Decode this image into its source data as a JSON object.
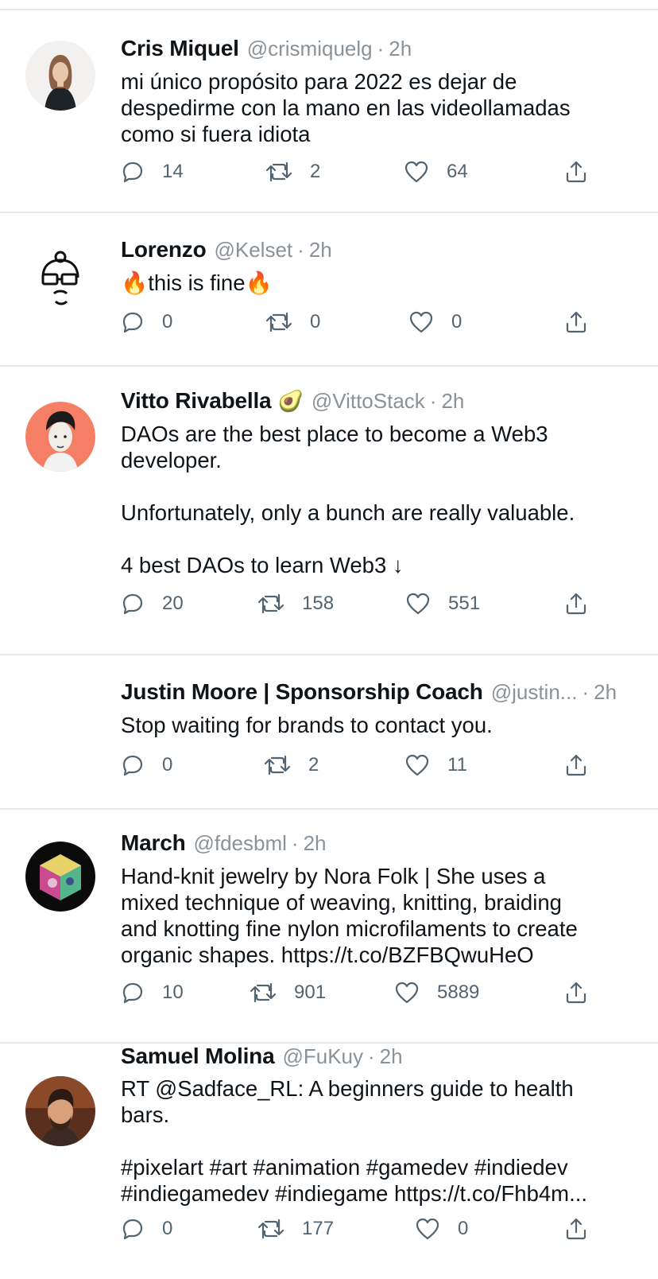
{
  "tweets": [
    {
      "name": "Cris Miquel",
      "handle": "@crismiquelg",
      "sep": "·",
      "time": "2h",
      "text": "mi único propósito para 2022 es dejar de\ndespedirme con la mano en las videollamadas\ncomo si fuera idiota",
      "replies": "14",
      "retweets": "2",
      "likes": "64"
    },
    {
      "name": "Lorenzo",
      "handle": "@Kelset",
      "sep": "·",
      "time": "2h",
      "text": "🔥this is fine🔥",
      "replies": "0",
      "retweets": "0",
      "likes": "0"
    },
    {
      "name": "Vitto Rivabella",
      "badge": "🥑",
      "handle": "@VittoStack",
      "sep": "·",
      "time": "2h",
      "text": "DAOs are the best place to become a Web3\ndeveloper.\n\nUnfortunately, only a bunch are really valuable.\n\n4 best DAOs to learn Web3  ↓",
      "replies": "20",
      "retweets": "158",
      "likes": "551"
    },
    {
      "name": "Justin Moore | Sponsorship Coach",
      "handle": "@justin...",
      "sep": "·",
      "time": "2h",
      "text": "Stop waiting for brands to contact you.",
      "replies": "0",
      "retweets": "2",
      "likes": "11"
    },
    {
      "name": "March",
      "handle": "@fdesbml",
      "sep": "·",
      "time": "2h",
      "text": "Hand-knit jewelry by Nora Folk | She uses a\nmixed technique of weaving, knitting, braiding\nand knotting fine nylon microfilaments to create\norganic shapes. https://t.co/BZFBQwuHeO",
      "replies": "10",
      "retweets": "901",
      "likes": "5889"
    },
    {
      "name": "Samuel Molina",
      "handle": "@FuKuy",
      "sep": "·",
      "time": "2h",
      "text": "RT @Sadface_RL: A beginners guide to health\nbars.\n\n#pixelart #art #animation #gamedev #indiedev\n#indiegamedev #indiegame https://t.co/Fhb4m...",
      "replies": "0",
      "retweets": "177",
      "likes": "0"
    }
  ],
  "icons": {
    "reply": "reply-icon",
    "retweet": "retweet-icon",
    "like": "heart-icon",
    "share": "share-icon"
  },
  "colors": {
    "text": "#0f1419",
    "secondary": "#8a9299",
    "icon": "#536471",
    "divider": "#e6e9ec"
  }
}
